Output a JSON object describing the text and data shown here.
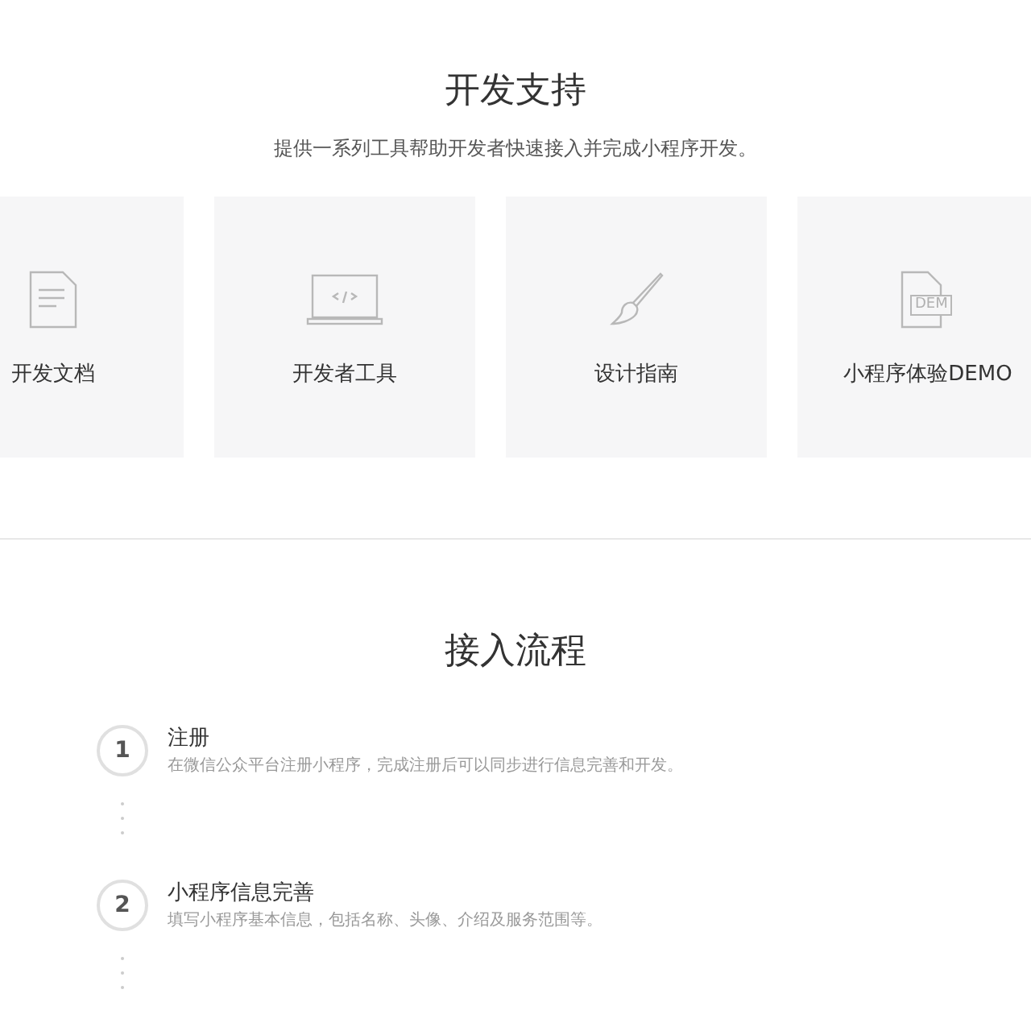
{
  "support": {
    "title": "开发支持",
    "subtitle": "提供一系列工具帮助开发者快速接入并完成小程序开发。",
    "cards": [
      {
        "kind": "document",
        "label": "开发文档"
      },
      {
        "kind": "laptop",
        "label": "开发者工具"
      },
      {
        "kind": "brush",
        "label": "设计指南"
      },
      {
        "kind": "demo",
        "label": "小程序体验DEMO",
        "badge": "DEM"
      }
    ]
  },
  "process": {
    "title": "接入流程",
    "steps": [
      {
        "number": "1",
        "title": "注册",
        "description": "在微信公众平台注册小程序，完成注册后可以同步进行信息完善和开发。"
      },
      {
        "number": "2",
        "title": "小程序信息完善",
        "description": "填写小程序基本信息，包括名称、头像、介绍及服务范围等。"
      }
    ]
  }
}
